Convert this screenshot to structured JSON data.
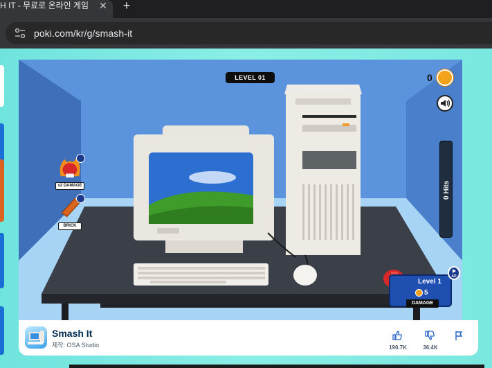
{
  "browser": {
    "tab_title": "H IT - 무료로 온라인 게임",
    "tab_close": "✕",
    "new_tab": "+",
    "url": "poki.com/kr/g/smash-it"
  },
  "game": {
    "level": "LEVEL 01",
    "coins": "0",
    "hits": "0 Hits",
    "powerups": [
      {
        "label": "x2 DAMAGE",
        "icon": "boxing-glove-fire-icon"
      },
      {
        "label": "BRICK",
        "icon": "brick-icon"
      }
    ],
    "damage_panel": {
      "level": "Level 1",
      "cost": "5",
      "label": "DAMAGE",
      "ad_label": "AD"
    }
  },
  "info": {
    "title": "Smash It",
    "author": "제작: OSA Studio",
    "likes": "190.7K",
    "dislikes": "36.4K"
  },
  "colors": {
    "accent": "#1f4fb0",
    "coin": "#f2a21b",
    "page_bg": "#7fe6df"
  }
}
